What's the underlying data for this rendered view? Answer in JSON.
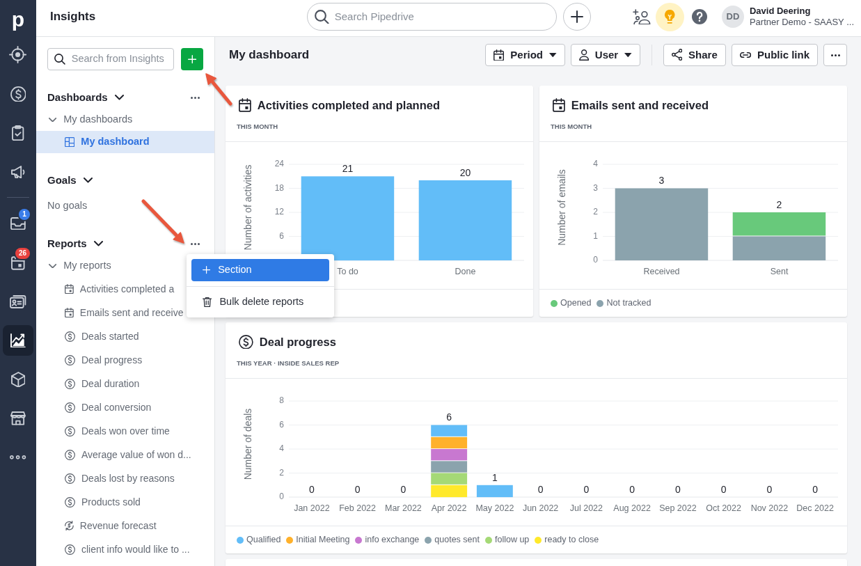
{
  "nav_rail": {
    "logo": "p",
    "groups": [
      {
        "items": [
          {
            "selected": false
          },
          {
            "selected": false
          },
          {
            "selected": false
          },
          {
            "selected": false
          }
        ]
      },
      {
        "items": [
          {
            "selected": false,
            "badge": {
              "text": "1",
              "color": "#3b7de9"
            }
          },
          {
            "selected": false,
            "badge": {
              "text": "26",
              "color": "#e8413e"
            }
          },
          {
            "selected": false
          },
          {
            "selected": true
          },
          {
            "selected": false
          },
          {
            "selected": false
          },
          {
            "selected": false
          }
        ]
      }
    ]
  },
  "topbar": {
    "title": "Insights",
    "search": {
      "placeholder": "Search Pipedrive"
    },
    "user": {
      "initials": "DD",
      "name": "David Deering",
      "org": "Partner Demo - SAASY ..."
    }
  },
  "sidebar": {
    "search": {
      "placeholder": "Search from Insights"
    },
    "sections": [
      {
        "title": "Dashboards",
        "expanded": true,
        "more_button": true,
        "groups": [
          {
            "label": "My dashboards",
            "expanded": true,
            "children": [
              {
                "label": "My dashboard",
                "kind": "dashboard",
                "selected": true
              }
            ]
          }
        ]
      },
      {
        "title": "Goals",
        "expanded": true,
        "more_button": false,
        "empty_text": "No goals"
      },
      {
        "title": "Reports",
        "expanded": true,
        "more_button": true,
        "groups": [
          {
            "label": "My reports",
            "expanded": true,
            "children": [
              {
                "label": "Activities completed a",
                "kind": "activity",
                "selected": false
              },
              {
                "label": "Emails sent and receive",
                "kind": "activity",
                "selected": false
              },
              {
                "label": "Deals started",
                "kind": "deal",
                "selected": false
              },
              {
                "label": "Deal progress",
                "kind": "deal",
                "selected": false
              },
              {
                "label": "Deal duration",
                "kind": "deal",
                "selected": false
              },
              {
                "label": "Deal conversion",
                "kind": "deal",
                "selected": false
              },
              {
                "label": "Deals won over time",
                "kind": "deal",
                "selected": false
              },
              {
                "label": "Average value of won d...",
                "kind": "deal",
                "selected": false
              },
              {
                "label": "Deals lost by reasons",
                "kind": "deal",
                "selected": false
              },
              {
                "label": "Products sold",
                "kind": "deal",
                "selected": false
              },
              {
                "label": "Revenue forecast",
                "kind": "forecast",
                "selected": false
              },
              {
                "label": "client info would like to ...",
                "kind": "deal",
                "selected": false
              }
            ]
          }
        ]
      }
    ]
  },
  "popup_menu": {
    "items": [
      {
        "label": "Section",
        "kind": "add",
        "highlighted": true
      },
      {
        "label": "Bulk delete reports",
        "kind": "delete",
        "highlighted": false
      }
    ]
  },
  "dashboard": {
    "title": "My dashboard",
    "filters": [
      {
        "label": "Period",
        "kind": "period"
      },
      {
        "label": "User",
        "kind": "user"
      }
    ],
    "actions": [
      {
        "label": "Share",
        "kind": "share"
      },
      {
        "label": "Public link",
        "kind": "link"
      }
    ],
    "cards": [
      {
        "title": "Activities completed and planned",
        "kind": "activity",
        "subtitle": "THIS MONTH",
        "chart_data": {
          "type": "bar",
          "ylabel": "Number of activities",
          "categories": [
            "To do",
            "Done"
          ],
          "series": [
            {
              "color": "#62bdf8",
              "values": [
                21,
                20
              ]
            }
          ],
          "ylim": [
            0,
            24
          ],
          "yticks": [
            6,
            12,
            18,
            24
          ],
          "grid": true,
          "data_labels": true
        }
      },
      {
        "title": "Emails sent and received",
        "kind": "activity",
        "subtitle": "THIS MONTH",
        "chart_data": {
          "type": "bar",
          "ylabel": "Number of emails",
          "categories": [
            "Received",
            "Sent"
          ],
          "series": [
            {
              "name": "Opened",
              "color": "#68c97b",
              "values": [
                0,
                1
              ]
            },
            {
              "name": "Not tracked",
              "color": "#8ba3ad",
              "values": [
                3,
                1
              ]
            }
          ],
          "stacked": true,
          "ylim": [
            0,
            4
          ],
          "yticks": [
            0,
            1,
            2,
            3,
            4
          ],
          "grid": true,
          "legend": "bottom",
          "value_labels": [
            [
              null,
              "2"
            ],
            [
              "3",
              null
            ]
          ]
        }
      },
      {
        "title": "Deal progress",
        "kind": "deal",
        "subtitle": "THIS YEAR · INSIDE SALES REP",
        "chart_data": {
          "type": "bar",
          "ylabel": "Number of deals",
          "categories": [
            "Jan 2022",
            "Feb 2022",
            "Mar 2022",
            "Apr 2022",
            "May 2022",
            "Jun 2022",
            "Jul 2022",
            "Aug 2022",
            "Sep 2022",
            "Oct 2022",
            "Nov 2022",
            "Dec 2022"
          ],
          "series": [
            {
              "name": "Qualified",
              "color": "#62bdf8",
              "values": [
                0,
                0,
                0,
                1,
                1,
                0,
                0,
                0,
                0,
                0,
                0,
                0
              ]
            },
            {
              "name": "Initial Meeting",
              "color": "#ffb12b",
              "values": [
                0,
                0,
                0,
                1,
                0,
                0,
                0,
                0,
                0,
                0,
                0,
                0
              ]
            },
            {
              "name": "info exchange",
              "color": "#c878d0",
              "values": [
                0,
                0,
                0,
                1,
                0,
                0,
                0,
                0,
                0,
                0,
                0,
                0
              ]
            },
            {
              "name": "quotes sent",
              "color": "#8ba3ad",
              "values": [
                0,
                0,
                0,
                1,
                0,
                0,
                0,
                0,
                0,
                0,
                0,
                0
              ]
            },
            {
              "name": "follow up",
              "color": "#a5d976",
              "values": [
                0,
                0,
                0,
                1,
                0,
                0,
                0,
                0,
                0,
                0,
                0,
                0
              ]
            },
            {
              "name": "ready to close",
              "color": "#ffe92b",
              "values": [
                0,
                0,
                0,
                1,
                0,
                0,
                0,
                0,
                0,
                0,
                0,
                0
              ]
            }
          ],
          "stacked": true,
          "ylim": [
            0,
            8
          ],
          "yticks": [
            0,
            2,
            4,
            6,
            8
          ],
          "grid": true,
          "legend": "bottom",
          "value_labels": [
            [
              "0",
              "0",
              "0",
              "6",
              "1",
              "0",
              "0",
              "0",
              "0",
              "0",
              "0",
              "0"
            ],
            [
              null,
              null,
              null,
              null,
              null,
              null,
              null,
              null,
              null,
              null,
              null,
              null
            ],
            [
              null,
              null,
              null,
              null,
              null,
              null,
              null,
              null,
              null,
              null,
              null,
              null
            ],
            [
              null,
              null,
              null,
              null,
              null,
              null,
              null,
              null,
              null,
              null,
              null,
              null
            ],
            [
              null,
              null,
              null,
              null,
              null,
              null,
              null,
              null,
              null,
              null,
              null,
              null
            ],
            [
              null,
              null,
              null,
              null,
              null,
              null,
              null,
              null,
              null,
              null,
              null,
              null
            ]
          ]
        }
      }
    ]
  }
}
